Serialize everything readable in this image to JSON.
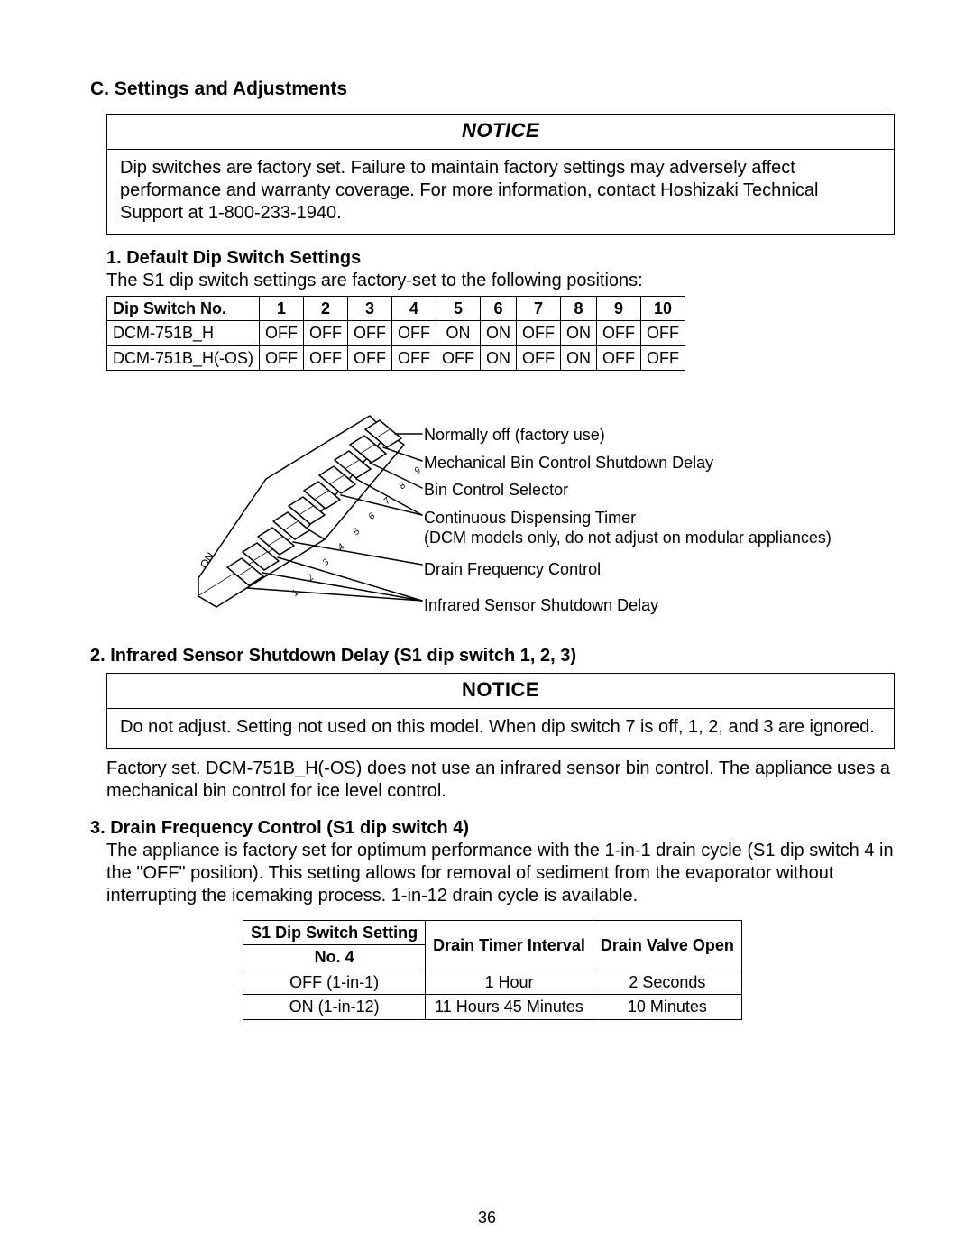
{
  "section": {
    "title": "C. Settings and Adjustments"
  },
  "notice1": {
    "header": "NOTICE",
    "body": "Dip switches are factory set. Failure to maintain factory settings may adversely affect performance and warranty coverage. For more information, contact Hoshizaki Technical Support at 1-800-233-1940."
  },
  "sub1": {
    "heading": "1. Default Dip Switch Settings",
    "intro": "The S1 dip switch settings are factory-set to the following positions:"
  },
  "dipTable": {
    "header": {
      "label": "Dip Switch No.",
      "cols": [
        "1",
        "2",
        "3",
        "4",
        "5",
        "6",
        "7",
        "8",
        "9",
        "10"
      ]
    },
    "rows": [
      {
        "model": "DCM-751B_H",
        "vals": [
          "OFF",
          "OFF",
          "OFF",
          "OFF",
          "ON",
          "ON",
          "OFF",
          "ON",
          "OFF",
          "OFF"
        ]
      },
      {
        "model": "DCM-751B_H(-OS)",
        "vals": [
          "OFF",
          "OFF",
          "OFF",
          "OFF",
          "OFF",
          "ON",
          "OFF",
          "ON",
          "OFF",
          "OFF"
        ]
      }
    ]
  },
  "callouts": {
    "c0": "Normally off (factory use)",
    "c1": "Mechanical Bin Control Shutdown Delay",
    "c2": "Bin Control Selector",
    "c3": "Continuous Dispensing Timer",
    "c3b": "(DCM models only, do not adjust on modular appliances)",
    "c4": "Drain Frequency Control",
    "c5": "Infrared Sensor Shutdown Delay",
    "on_label": "ON"
  },
  "sub2": {
    "heading": "2. Infrared Sensor Shutdown Delay (S1 dip switch 1, 2, 3)"
  },
  "notice2": {
    "header": "NOTICE",
    "body": "Do not adjust. Setting not used on this model. When dip switch 7 is off, 1, 2, and 3 are ignored."
  },
  "sub2body": "Factory set. DCM-751B_H(-OS) does not use an infrared sensor bin control. The appliance uses a mechanical bin control for ice level control.",
  "sub3": {
    "heading": "3. Drain Frequency Control (S1 dip switch 4)",
    "body": "The appliance is factory set for optimum performance with the 1-in-1 drain cycle (S1 dip switch 4 in the \"OFF\" position). This setting allows for removal of sediment from the evaporator without interrupting the icemaking process. 1-in-12 drain cycle is available."
  },
  "drainTable": {
    "head": {
      "c0a": "S1 Dip Switch Setting",
      "c0b": "No. 4",
      "c1": "Drain Timer Interval",
      "c2": "Drain Valve Open"
    },
    "rows": [
      {
        "a": "OFF (1-in-1)",
        "b": "1 Hour",
        "c": "2 Seconds"
      },
      {
        "a": "ON (1-in-12)",
        "b": "11 Hours 45 Minutes",
        "c": "10 Minutes"
      }
    ]
  },
  "pageNumber": "36"
}
